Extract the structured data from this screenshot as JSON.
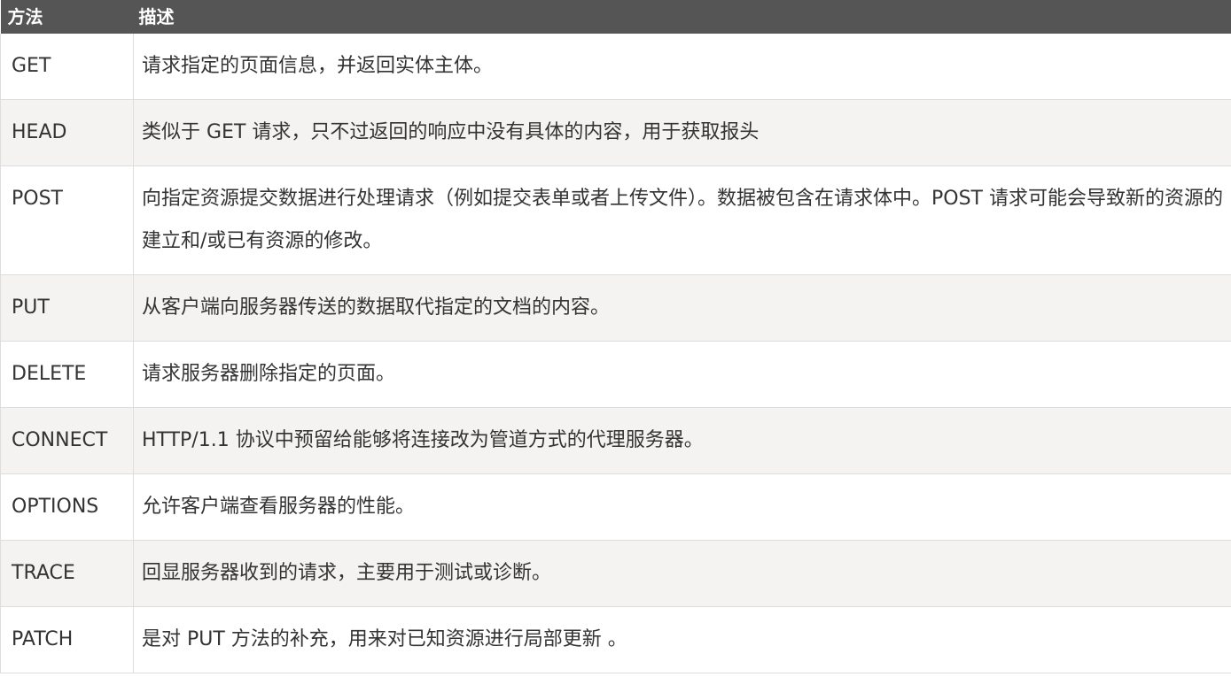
{
  "header": {
    "method_label": "方法",
    "desc_label": "描述"
  },
  "rows": [
    {
      "method": "GET",
      "desc": "请求指定的页面信息，并返回实体主体。"
    },
    {
      "method": "HEAD",
      "desc": "类似于 GET 请求，只不过返回的响应中没有具体的内容，用于获取报头"
    },
    {
      "method": "POST",
      "desc": "向指定资源提交数据进行处理请求（例如提交表单或者上传文件）。数据被包含在请求体中。POST 请求可能会导致新的资源的建立和/或已有资源的修改。"
    },
    {
      "method": "PUT",
      "desc": "从客户端向服务器传送的数据取代指定的文档的内容。"
    },
    {
      "method": "DELETE",
      "desc": "请求服务器删除指定的页面。"
    },
    {
      "method": "CONNECT",
      "desc": "HTTP/1.1 协议中预留给能够将连接改为管道方式的代理服务器。"
    },
    {
      "method": "OPTIONS",
      "desc": "允许客户端查看服务器的性能。"
    },
    {
      "method": "TRACE",
      "desc": "回显服务器收到的请求，主要用于测试或诊断。"
    },
    {
      "method": "PATCH",
      "desc": "是对 PUT 方法的补充，用来对已知资源进行局部更新 。"
    }
  ],
  "colors": {
    "header_bg": "#555555",
    "header_text": "#ffffff",
    "row_alt_bg": "#f4f3f1",
    "border": "#dddddd",
    "text": "#333333"
  }
}
